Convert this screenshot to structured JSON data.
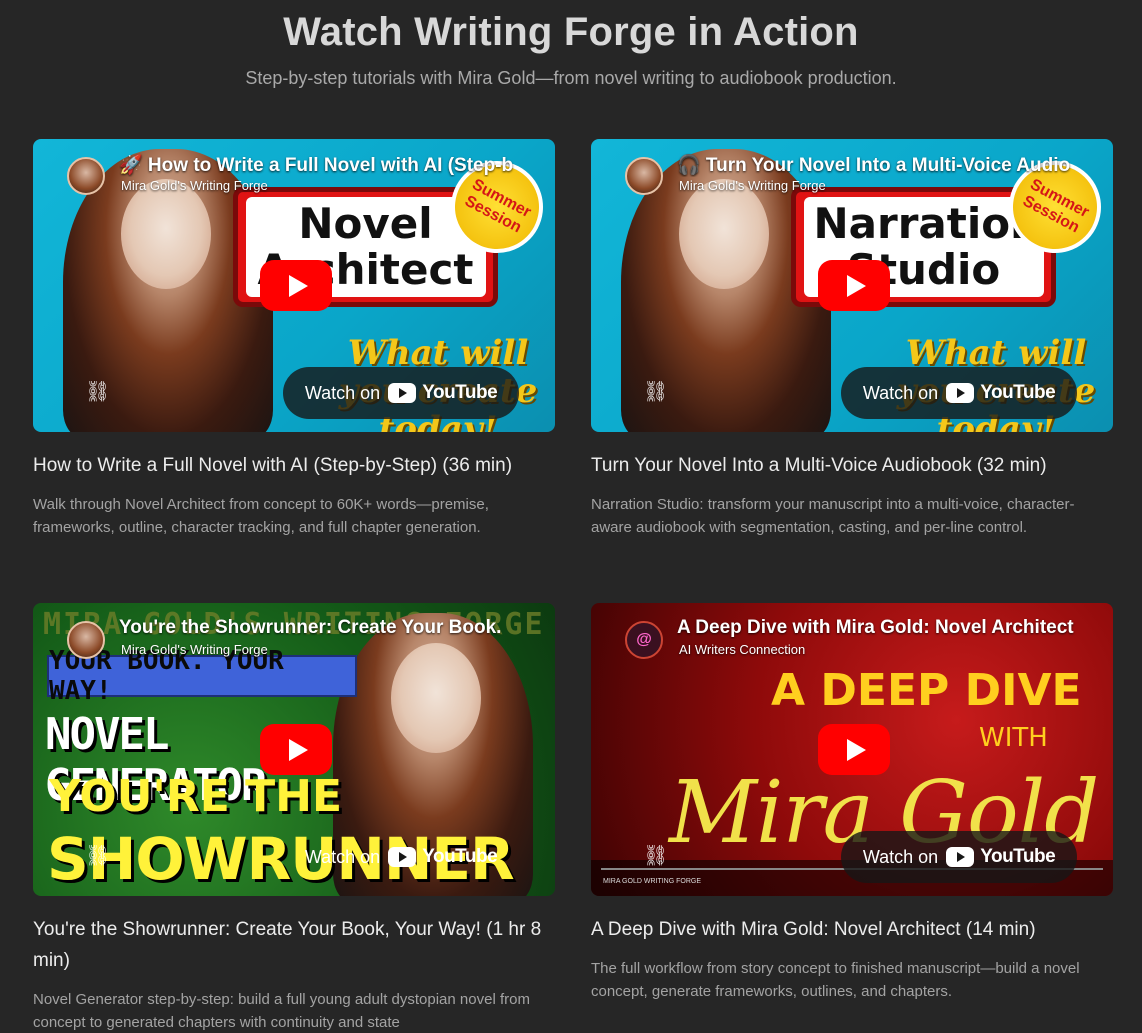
{
  "header": {
    "title": "Watch Writing Forge in Action",
    "subtitle": "Step-by-step tutorials with Mira Gold—from novel writing to audiobook production."
  },
  "youtube": {
    "watch_label": "Watch on",
    "logo_text": "YouTube"
  },
  "videos": [
    {
      "embed_title": "🚀 How to Write a Full Novel with AI (Step-b",
      "channel": "Mira Gold's Writing Forge",
      "thumb_text": "Novel Architect",
      "thumb_sticker": "Summer Session",
      "thumb_slogan": "What will you create today!",
      "title": "How to Write a Full Novel with AI (Step-by-Step) (36 min)",
      "description": "Walk through Novel Architect from concept to 60K+ words—premise, frameworks, outline, character tracking, and full chapter generation."
    },
    {
      "embed_title": "🎧 Turn Your Novel Into a Multi-Voice Audio",
      "channel": "Mira Gold's Writing Forge",
      "thumb_text": "Narration Studio",
      "thumb_sticker": "Summer Session",
      "thumb_slogan": "What will you create today!",
      "title": "Turn Your Novel Into a Multi-Voice Audiobook (32 min)",
      "description": "Narration Studio: transform your manuscript into a multi-voice, character-aware audiobook with segmentation, casting, and per-line control."
    },
    {
      "embed_title": "You're the Showrunner: Create Your Book.",
      "channel": "Mira Gold's Writing Forge",
      "thumb_top": "MIRA GOLD'S WRITING FORGE",
      "thumb_banner": "YOUR BOOK. YOUR WAY!",
      "thumb_line1": "NOVEL GENERATOR",
      "thumb_line2": "YOU'RE THE",
      "thumb_line3": "SHOWRUNNER",
      "title": "You're the Showrunner: Create Your Book, Your Way! (1 hr 8 min)",
      "description": "Novel Generator step-by-step: build a full young adult dystopian novel from concept to generated chapters with continuity and state"
    },
    {
      "embed_title": "A Deep Dive with Mira Gold: Novel Architect",
      "channel": "AI Writers Connection",
      "avatar_text": "@",
      "thumb_line1": "A DEEP DIVE",
      "thumb_line2": "WITH",
      "thumb_line3": "Mira Gold",
      "thumb_footer": "MIRA GOLD  WRITING FORGE",
      "title": "A Deep Dive with Mira Gold: Novel Architect (14 min)",
      "description": "The full workflow from story concept to finished manuscript—build a novel concept, generate frameworks, outlines, and chapters."
    }
  ]
}
